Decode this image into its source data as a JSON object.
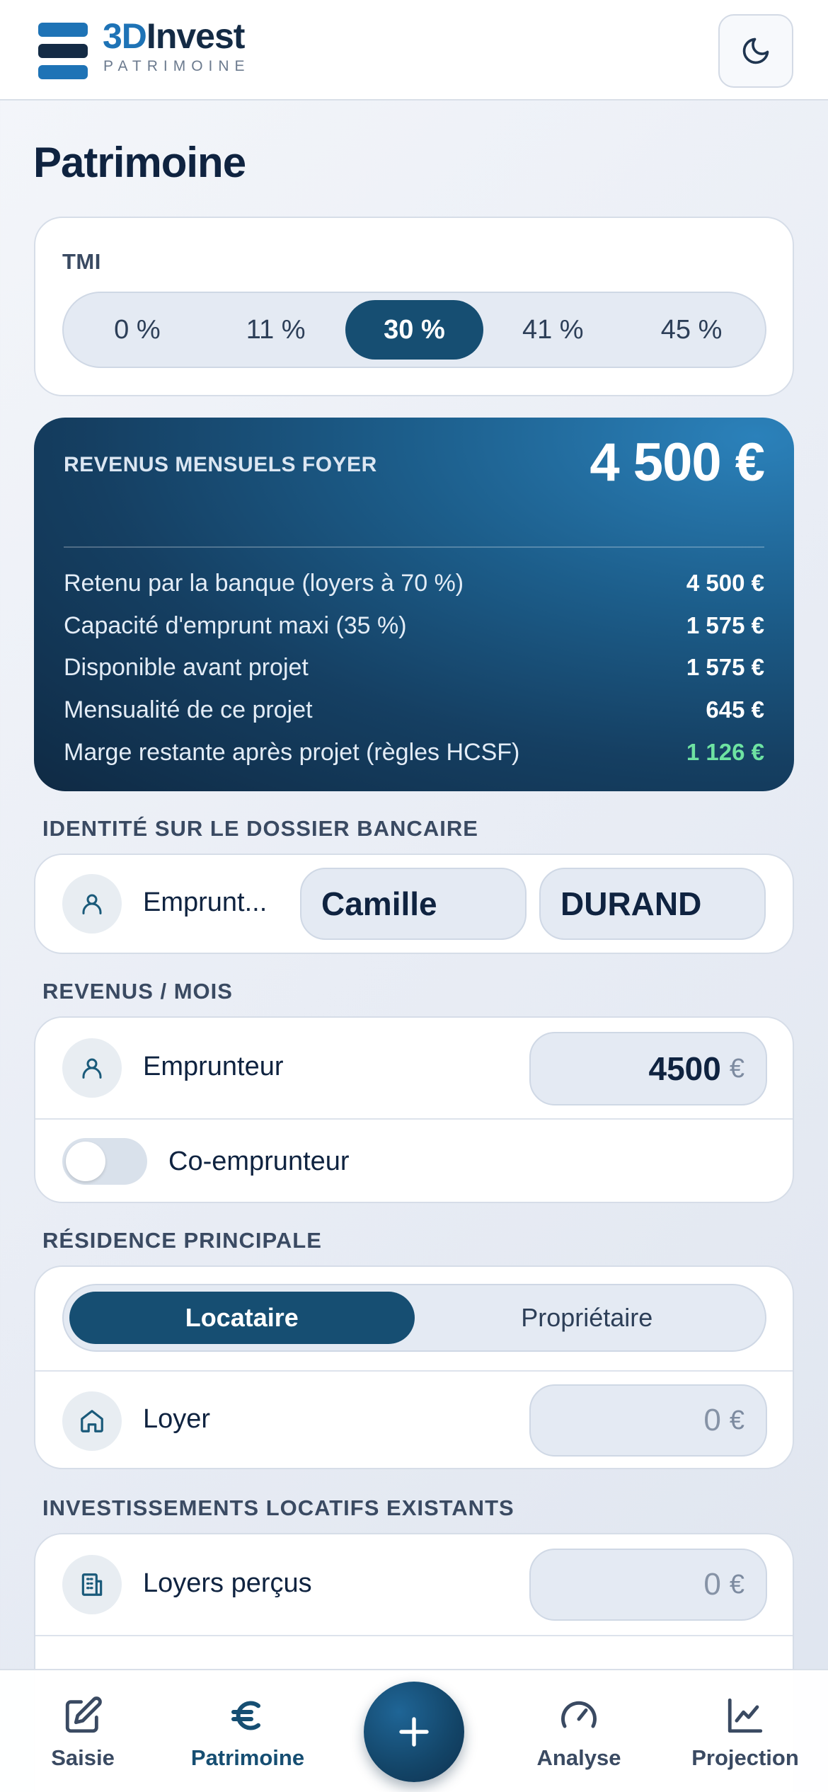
{
  "app": {
    "brand_part1": "3D",
    "brand_part2": "Invest",
    "brand_sub": "PATRIMOINE"
  },
  "page_title": "Patrimoine",
  "tmi": {
    "label": "TMI",
    "options": [
      "0 %",
      "11 %",
      "30 %",
      "41 %",
      "45 %"
    ],
    "selected": "30 %"
  },
  "revenus": {
    "title": "REVENUS MENSUELS FOYER",
    "total": "4 500 €",
    "rows": [
      {
        "label": "Retenu par la banque (loyers à 70 %)",
        "value": "4 500 €"
      },
      {
        "label": "Capacité d'emprunt maxi (35 %)",
        "value": "1 575 €"
      },
      {
        "label": "Disponible avant projet",
        "value": "1 575 €"
      },
      {
        "label": "Mensualité de ce projet",
        "value": "645 €"
      },
      {
        "label": "Marge restante après projet (règles HCSF)",
        "value": "1 126 €"
      }
    ]
  },
  "identite": {
    "heading": "IDENTITÉ SUR LE DOSSIER BANCAIRE",
    "label": "Emprunt...",
    "first_name": "Camille",
    "last_name": "DURAND"
  },
  "revenus_mois": {
    "heading": "REVENUS / MOIS",
    "emprunteur_label": "Emprunteur",
    "emprunteur_value": "4500",
    "currency": "€",
    "coemprunteur_label": "Co-emprunteur",
    "coemprunteur_enabled": false
  },
  "residence": {
    "heading": "RÉSIDENCE PRINCIPALE",
    "options": [
      "Locataire",
      "Propriétaire"
    ],
    "selected": "Locataire",
    "loyer_label": "Loyer",
    "loyer_value": "0",
    "currency": "€"
  },
  "investissements": {
    "heading": "INVESTISSEMENTS LOCATIFS EXISTANTS",
    "loyers_label": "Loyers perçus",
    "loyers_value": "0",
    "currency": "€"
  },
  "nav": {
    "items": [
      "Saisie",
      "Patrimoine",
      "Analyse",
      "Projection"
    ],
    "active": "Patrimoine"
  }
}
